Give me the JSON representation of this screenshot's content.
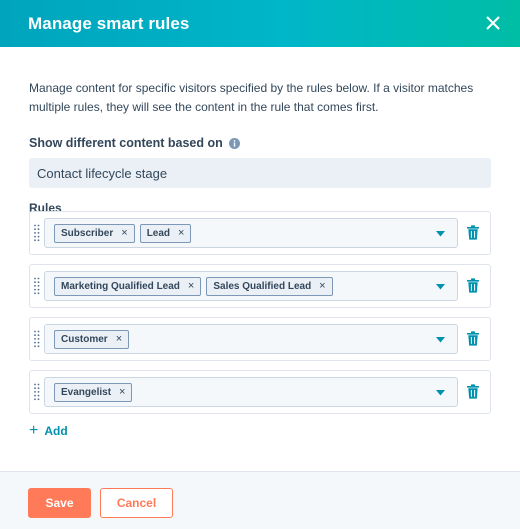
{
  "modal": {
    "title": "Manage smart rules",
    "close_icon": "close-icon"
  },
  "description": "Manage content for specific visitors specified by the rules below. If a visitor matches multiple rules, they will see the content in the rule that comes first.",
  "criteria": {
    "label": "Show different content based on",
    "info_icon": "info-icon",
    "value": "Contact lifecycle stage"
  },
  "rules": {
    "label": "Rules",
    "items": [
      {
        "tags": [
          "Subscriber",
          "Lead"
        ]
      },
      {
        "tags": [
          "Marketing Qualified Lead",
          "Sales Qualified Lead"
        ]
      },
      {
        "tags": [
          "Customer"
        ]
      },
      {
        "tags": [
          "Evangelist"
        ]
      }
    ],
    "remove_glyph": "×",
    "add_label": "Add",
    "add_glyph": "+"
  },
  "footer": {
    "save_label": "Save",
    "cancel_label": "Cancel"
  },
  "colors": {
    "header_gradient_start": "#00a4bd",
    "header_gradient_end": "#00bda5",
    "primary_button": "#ff7a59",
    "link": "#0091ae",
    "text": "#33475b",
    "tag_bg": "#eaf0f6"
  }
}
